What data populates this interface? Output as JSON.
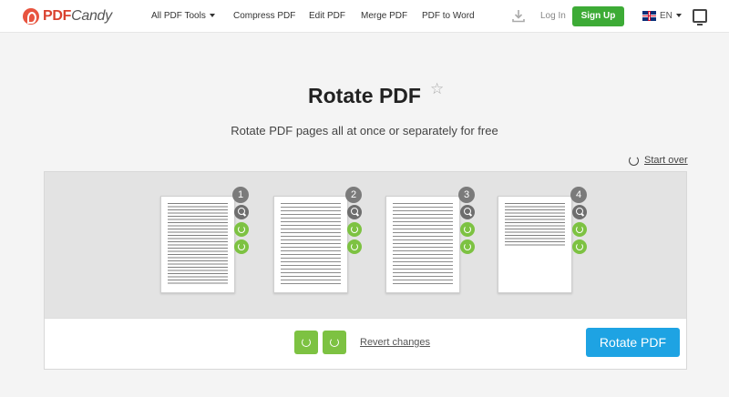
{
  "header": {
    "logo_brand": "PDF",
    "logo_suffix": "Candy",
    "nav": [
      "All PDF Tools",
      "Compress PDF",
      "Edit PDF",
      "Merge PDF",
      "PDF to Word"
    ],
    "login": "Log In",
    "signup": "Sign Up",
    "language": "EN"
  },
  "main": {
    "title": "Rotate PDF",
    "subtitle": "Rotate PDF pages all at once or separately for free",
    "start_over": "Start over"
  },
  "pages": [
    {
      "number": "1"
    },
    {
      "number": "2"
    },
    {
      "number": "3"
    },
    {
      "number": "4"
    }
  ],
  "actions": {
    "revert": "Revert changes",
    "rotate": "Rotate PDF"
  },
  "colors": {
    "accent_green": "#3dab36",
    "rotate_green": "#7dc242",
    "primary_blue": "#1ea3e3",
    "brand_red": "#d9412e"
  }
}
